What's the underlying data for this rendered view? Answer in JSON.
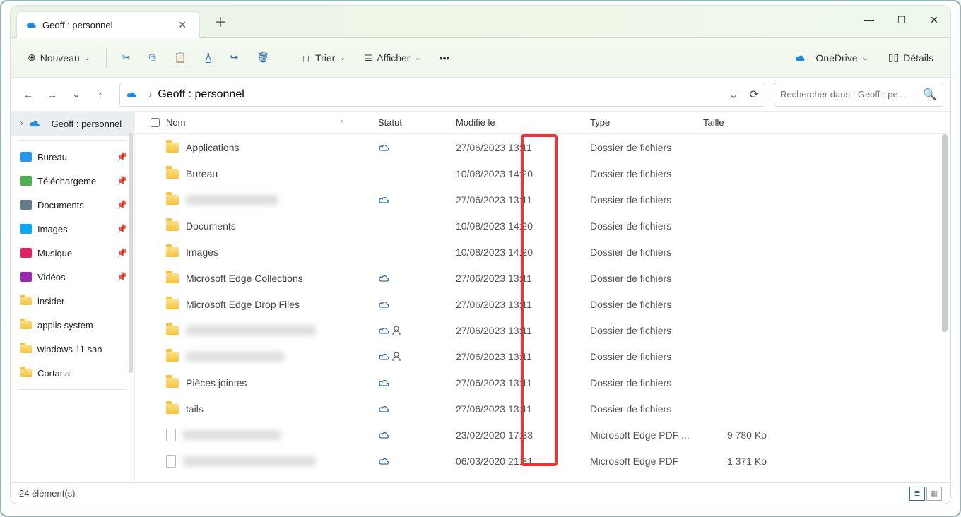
{
  "tab_title": "Geoff : personnel",
  "toolbar": {
    "new_label": "Nouveau",
    "sort_label": "Trier",
    "view_label": "Afficher",
    "onedrive_label": "OneDrive",
    "details_label": "Détails"
  },
  "breadcrumb": {
    "root": "Geoff : personnel"
  },
  "search": {
    "placeholder": "Rechercher dans : Geoff : pe..."
  },
  "sidebar_active": "Geoff : personnel",
  "sidebar_items": [
    {
      "label": "Bureau",
      "icon": "desktop",
      "pinned": true
    },
    {
      "label": "Téléchargeme",
      "icon": "download",
      "pinned": true
    },
    {
      "label": "Documents",
      "icon": "document",
      "pinned": true
    },
    {
      "label": "Images",
      "icon": "image",
      "pinned": true
    },
    {
      "label": "Musique",
      "icon": "music",
      "pinned": true
    },
    {
      "label": "Vidéos",
      "icon": "video",
      "pinned": true
    },
    {
      "label": "insider",
      "icon": "folder",
      "pinned": false
    },
    {
      "label": "applis system",
      "icon": "folder",
      "pinned": false
    },
    {
      "label": "windows 11 san",
      "icon": "folder",
      "pinned": false
    },
    {
      "label": "Cortana",
      "icon": "folder",
      "pinned": false
    }
  ],
  "columns": {
    "name": "Nom",
    "statut": "Statut",
    "modified": "Modifié le",
    "type": "Type",
    "size": "Taille"
  },
  "rows": [
    {
      "name": "Applications",
      "icon": "folder",
      "statut": "cloud",
      "modified": "27/06/2023 13:11",
      "type": "Dossier de fichiers",
      "size": ""
    },
    {
      "name": "Bureau",
      "icon": "folder",
      "statut": "",
      "modified": "10/08/2023 14:20",
      "type": "Dossier de fichiers",
      "size": ""
    },
    {
      "name": "",
      "redacted": true,
      "icon": "folder",
      "statut": "cloud",
      "modified": "27/06/2023 13:11",
      "type": "Dossier de fichiers",
      "size": ""
    },
    {
      "name": "Documents",
      "icon": "folder",
      "statut": "",
      "modified": "10/08/2023 14:20",
      "type": "Dossier de fichiers",
      "size": ""
    },
    {
      "name": "Images",
      "icon": "folder",
      "statut": "",
      "modified": "10/08/2023 14:20",
      "type": "Dossier de fichiers",
      "size": ""
    },
    {
      "name": "Microsoft Edge Collections",
      "icon": "folder",
      "statut": "cloud",
      "modified": "27/06/2023 13:11",
      "type": "Dossier de fichiers",
      "size": ""
    },
    {
      "name": "Microsoft Edge Drop Files",
      "icon": "folder",
      "statut": "cloud",
      "modified": "27/06/2023 13:11",
      "type": "Dossier de fichiers",
      "size": ""
    },
    {
      "name": "",
      "redacted": true,
      "icon": "folder",
      "statut": "cloud-shared",
      "modified": "27/06/2023 13:11",
      "type": "Dossier de fichiers",
      "size": ""
    },
    {
      "name": "",
      "redacted": true,
      "icon": "folder",
      "statut": "cloud-shared",
      "modified": "27/06/2023 13:11",
      "type": "Dossier de fichiers",
      "size": ""
    },
    {
      "name": "Pièces jointes",
      "icon": "folder",
      "statut": "cloud",
      "modified": "27/06/2023 13:11",
      "type": "Dossier de fichiers",
      "size": ""
    },
    {
      "name": "tails",
      "icon": "folder",
      "statut": "cloud",
      "modified": "27/06/2023 13:11",
      "type": "Dossier de fichiers",
      "size": ""
    },
    {
      "name": "",
      "redacted": true,
      "icon": "file",
      "statut": "cloud",
      "modified": "23/02/2020 17:33",
      "type": "Microsoft Edge PDF ...",
      "size": "9 780 Ko"
    },
    {
      "name": "",
      "redacted": true,
      "icon": "file",
      "statut": "cloud",
      "modified": "06/03/2020 21:31",
      "type": "Microsoft Edge PDF",
      "size": "1 371 Ko"
    }
  ],
  "status": {
    "count": "24 élément(s)"
  }
}
